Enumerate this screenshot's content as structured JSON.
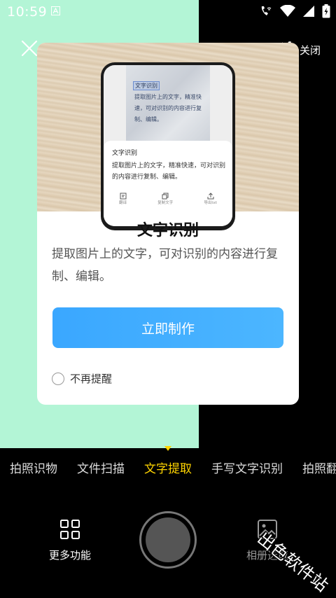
{
  "status_bar": {
    "time": "10:59"
  },
  "top_controls": {
    "flash_label": "关闭"
  },
  "dialog": {
    "title": "文字识别",
    "description": "提取图片上的文字，可对识别的内容进行复制、编辑。",
    "cta_label": "立即制作",
    "no_remind_label": "不再提醒",
    "illustration": {
      "paper_highlight": "文字识别",
      "paper_lines": [
        "提取图片上的文字，精准快",
        "速，可对识别的内容进行复",
        "制、编辑。"
      ],
      "sheet_title": "文字识别",
      "sheet_body": "提取图片上的文字，精准快速，可对识别的内容进行复制、编辑。",
      "actions": [
        "翻译",
        "复制文字",
        "导出txt"
      ]
    }
  },
  "mode_tabs": [
    {
      "label": "拍照识物",
      "active": false
    },
    {
      "label": "文件扫描",
      "active": false
    },
    {
      "label": "文字提取",
      "active": true
    },
    {
      "label": "手写文字识别",
      "active": false
    },
    {
      "label": "拍照翻",
      "active": false
    }
  ],
  "bottom_bar": {
    "more_label": "更多功能",
    "album_label": "相册选取"
  },
  "watermark": {
    "text": "出色软件站"
  },
  "colors": {
    "accent_yellow": "#ffd400",
    "cta_blue": "#3aa7ff",
    "camera_green": "#b3f5d6"
  }
}
